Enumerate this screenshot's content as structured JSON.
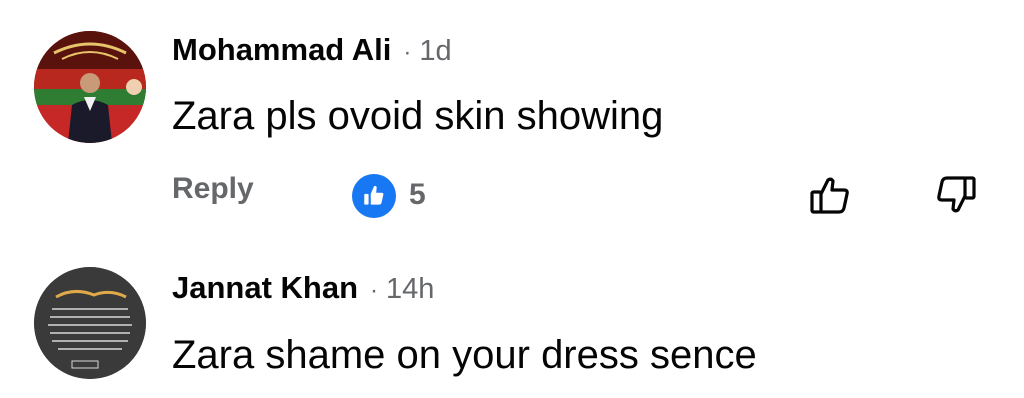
{
  "comments": [
    {
      "author": "Mohammad Ali",
      "separator": "·",
      "time": "1d",
      "text": "Zara pls ovoid skin showing",
      "reply_label": "Reply",
      "reaction_count": "5",
      "reaction_icon": "thumbs-up-icon",
      "like_icon": "thumbs-up-outline-icon",
      "dislike_icon": "thumbs-down-outline-icon"
    },
    {
      "author": "Jannat Khan",
      "separator": "·",
      "time": "14h",
      "text": "Zara shame on your dress sence"
    }
  ],
  "colors": {
    "text_primary": "#050505",
    "text_secondary": "#65676b",
    "reaction_blue": "#1877f2"
  }
}
